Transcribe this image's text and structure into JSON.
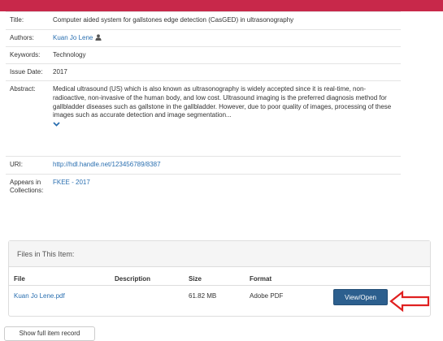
{
  "item": {
    "title_label": "Title:",
    "title": "Computer aided system for gallstones edge detection (CasGED) in ultrasonography",
    "authors_label": "Authors:",
    "author": "Kuan Jo Lene",
    "keywords_label": "Keywords:",
    "keywords": "Technology",
    "issue_date_label": "Issue Date:",
    "issue_date": "2017",
    "abstract_label": "Abstract:",
    "abstract": "Medical ultrasound (US) which is also known as ultrasonography is widely accepted since it is real-time, non-radioactive, non-invasive of the human body, and low cost. Ultrasound imaging is the preferred diagnosis method for gallbladder diseases such as gallstone in the gallbladder. However, due to poor quality of images, processing of these images such as accurate detection and image segmentation...",
    "uri_label": "URI:",
    "uri": "http://hdl.handle.net/123456789/8387",
    "collections_label": "Appears in Collections:",
    "collection": "FKEE - 2017"
  },
  "files": {
    "heading": "Files in This Item:",
    "columns": [
      "File",
      "Description",
      "Size",
      "Format"
    ],
    "rows": [
      {
        "file": "Kuan Jo Lene.pdf",
        "description": "",
        "size": "61.82 MB",
        "format": "Adobe PDF",
        "action": "View/Open"
      }
    ]
  },
  "footer": {
    "show_full_record": "Show full item record"
  },
  "colors": {
    "header_bar": "#c8284a",
    "link": "#2a6fb0",
    "view_button": "#2c5f8e",
    "arrow": "#e02020"
  },
  "icons": {
    "author": "user-icon",
    "expand": "chevron-down-icon",
    "pointer": "arrow-left-icon"
  }
}
